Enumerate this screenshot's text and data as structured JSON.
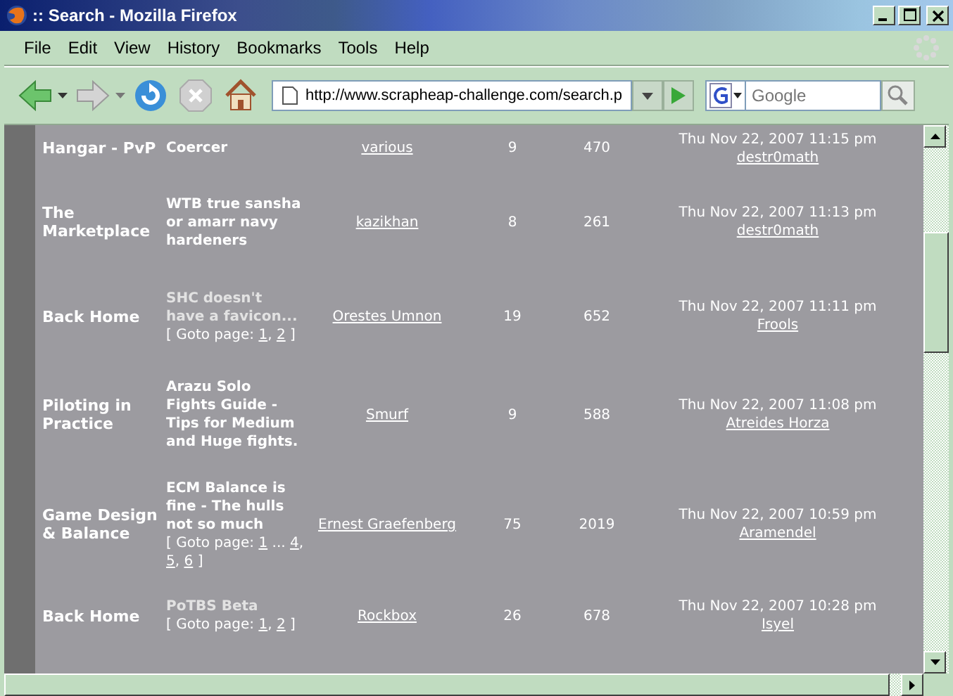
{
  "window": {
    "title": ":: Search - Mozilla Firefox"
  },
  "menu": [
    "File",
    "Edit",
    "View",
    "History",
    "Bookmarks",
    "Tools",
    "Help"
  ],
  "address_bar": {
    "value": "http://www.scrapheap-challenge.com/search.p"
  },
  "search": {
    "placeholder": "Google"
  },
  "topics": [
    {
      "forum": "Hangar - PvP",
      "title": "Coercer",
      "read": false,
      "author": "various",
      "replies": "9",
      "views": "470",
      "last_post_time": "Thu Nov 22, 2007 11:15 pm",
      "last_poster": "destr0math"
    },
    {
      "forum": "The Marketplace",
      "title": "WTB true sansha or amarr navy hardeners",
      "read": false,
      "author": "kazikhan",
      "replies": "8",
      "views": "261",
      "last_post_time": "Thu Nov 22, 2007 11:13 pm",
      "last_poster": "destr0math"
    },
    {
      "forum": "Back Home",
      "title": "SHC doesn't have a favicon...",
      "read": true,
      "goto_prefix": "[ Goto page:",
      "pages": [
        {
          "kind": "link",
          "label": "1",
          "after": ","
        },
        {
          "kind": "link",
          "label": "2"
        }
      ],
      "goto_suffix": "]",
      "author": "Orestes Umnon",
      "replies": "19",
      "views": "652",
      "last_post_time": "Thu Nov 22, 2007 11:11 pm",
      "last_poster": "Frools"
    },
    {
      "forum": "Piloting in Practice",
      "title": "Arazu Solo Fights Guide - Tips for Medium and Huge fights.",
      "read": false,
      "author": "Smurf",
      "replies": "9",
      "views": "588",
      "last_post_time": "Thu Nov 22, 2007 11:08 pm",
      "last_poster": "Atreides Horza"
    },
    {
      "forum": "Game Design & Balance",
      "title": "ECM Balance is fine - The hulls not so much",
      "read": false,
      "goto_prefix": "[ Goto page:",
      "pages": [
        {
          "kind": "link",
          "label": "1"
        },
        {
          "kind": "gap",
          "label": "..."
        },
        {
          "kind": "link",
          "label": "4",
          "after": ","
        },
        {
          "kind": "link",
          "label": "5",
          "after": ","
        },
        {
          "kind": "link",
          "label": "6"
        }
      ],
      "goto_suffix": "]",
      "author": "Ernest Graefenberg",
      "replies": "75",
      "views": "2019",
      "last_post_time": "Thu Nov 22, 2007 10:59 pm",
      "last_poster": "Aramendel"
    },
    {
      "forum": "Back Home",
      "title": "PoTBS Beta",
      "read": true,
      "goto_prefix": "[ Goto page:",
      "pages": [
        {
          "kind": "link",
          "label": "1",
          "after": ","
        },
        {
          "kind": "link",
          "label": "2"
        }
      ],
      "goto_suffix": "]",
      "author": "Rockbox",
      "replies": "26",
      "views": "678",
      "last_post_time": "Thu Nov 22, 2007 10:28 pm",
      "last_poster": "Isyel"
    }
  ]
}
